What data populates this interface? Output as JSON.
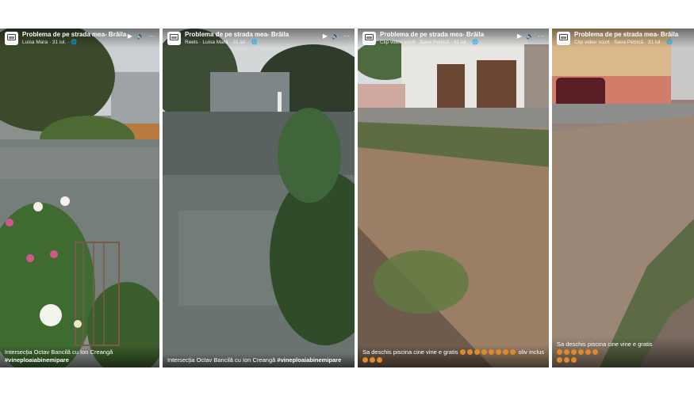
{
  "panels": [
    {
      "page_name": "Problema de pe strada mea- Brăila",
      "subtitle": "Luisa Mara · 31 iul. · ",
      "caption_text": "Intersecția Octav Bancilă cu Ion Creangă ",
      "hashtag": "#vineploaiabinemipare"
    },
    {
      "page_name": "Problema de pe strada mea- Brăila",
      "subtitle": "Reels · Luisa Mara · 31 iul. · ",
      "caption_text": "Intersecția Octav Bancilă cu Ion Creangă ",
      "hashtag": "#vineploaiabinemipare"
    },
    {
      "page_name": "Problema de pe strada mea- Brăila",
      "subtitle": "Clip video scurt · Sava Petrică · 31 iul. · ",
      "caption_text": "Sa deschis piscina cine vine e gratis ",
      "caption_suffix": " oliv inclus"
    },
    {
      "page_name": "Problema de pe strada mea- Brăila",
      "subtitle": "Clip video scurt · Sava Petrică · 31 iul. · ",
      "caption_text": "Sa deschis piscina cine vine e gratis "
    }
  ],
  "controls": {
    "play": "▶",
    "volume": "🔈",
    "more": "···"
  },
  "colors": {
    "overlay": "#000000",
    "text": "#ffffff",
    "emoji": "#e0892a"
  }
}
